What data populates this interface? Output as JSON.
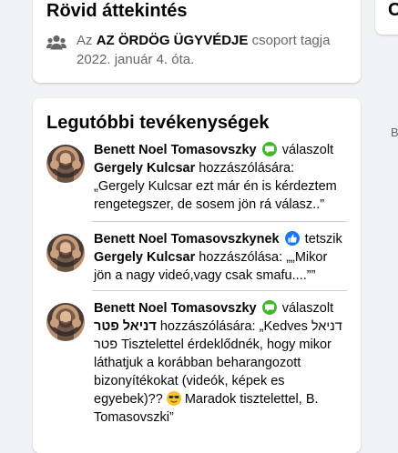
{
  "summary": {
    "title": "Rövid áttekintés",
    "text_before": "Az",
    "group_name": "AZ ÖRDÖG ÜGYVÉDJE",
    "text_after": "csoport tagja 2022. január 4. óta."
  },
  "right_card": {
    "letter": "C"
  },
  "side_letter": "B",
  "activity": {
    "title": "Legutóbbi tevékenységek",
    "items": [
      {
        "actor": "Benett Noel Tomasovszky",
        "action": "válaszolt",
        "target": "Gergely Kulcsar",
        "connector": "hozzászólására:",
        "quote": "„Gergely Kulcsar ezt már én is kérdeztem rengetegszer, de sosem jön rá válasz..”",
        "badge": "comment-icon"
      },
      {
        "actor": "Benett Noel Tomasovszkynek",
        "action": "tetszik",
        "target": "Gergely Kulcsar",
        "connector": "hozzászólása:",
        "quote": "„„Mikor jön a nagy videó,vagy csak smafu....””",
        "badge": "like-icon"
      },
      {
        "actor": "Benett Noel Tomasovszky",
        "action": "válaszolt",
        "target": "דניאל פטר",
        "connector": "hozzászólására:",
        "quote_start": "„Kedves דניאל פטר Tisztelettel érdeklődnék, hogy mikor láthatjuk a korábban beharangozott bizonyítékokat (videók, képek es egyebek)??",
        "quote_end": "Maradok tisztelettel, B. Tomasovszki”",
        "badge": "comment-icon",
        "emoji": "sunglasses-emoji"
      }
    ]
  },
  "colors": {
    "background": "#f0f2f5",
    "card": "#ffffff",
    "secondary_text": "#65676b",
    "comment_badge": "#42b72a",
    "like_badge": "#1877f2"
  }
}
